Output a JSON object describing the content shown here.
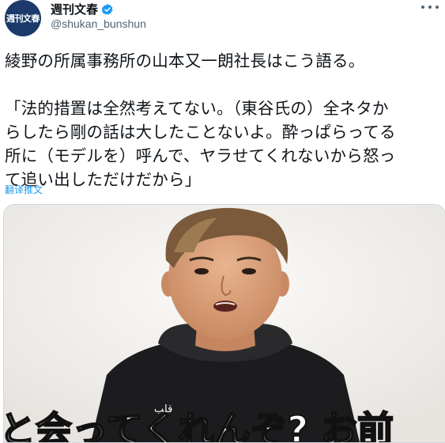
{
  "tweet": {
    "avatar_text": "週刊文春",
    "display_name": "週刊文春",
    "handle": "@shukan_bunshun",
    "text": "綾野の所属事務所の山本又一朗社長はこう語る。\n\n「法的措置は全然考えてない。（東谷氏の）全ネタか\nらしたら剛の話は大したことないよ。酔っぱらってる\n所に（モデルを）呼んで、ヤラせてくれないから怒っ\nて追い出しただけだから」",
    "translate_label": "翻译推文"
  },
  "media": {
    "caption": "と会ってくれんぞ? お前",
    "arabic_text": "قلب"
  },
  "colors": {
    "link": "#1d9bf0",
    "verified": "#1d9bf0",
    "caption_red": "#e60012"
  }
}
